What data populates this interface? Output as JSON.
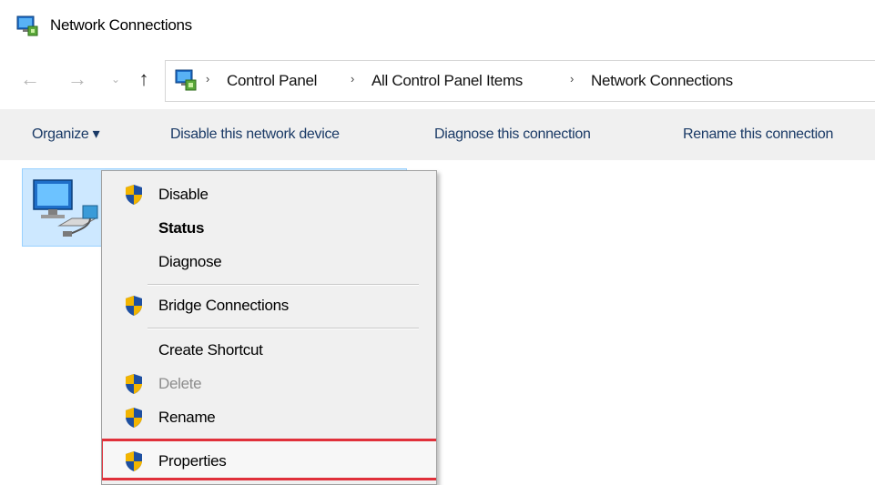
{
  "window": {
    "title": "Network Connections"
  },
  "nav": {
    "back": "←",
    "forward": "→",
    "recent": "⌄",
    "up": "↑",
    "breadcrumb": [
      "Control Panel",
      "All Control Panel Items",
      "Network Connections"
    ],
    "separator": "›"
  },
  "toolbar": {
    "organize": "Organize ▾",
    "disable_device": "Disable this network device",
    "diagnose": "Diagnose this connection",
    "rename": "Rename this connection"
  },
  "context_menu": {
    "items": [
      {
        "label": "Disable",
        "shield": true,
        "style": "normal"
      },
      {
        "label": "Status",
        "shield": false,
        "style": "bold"
      },
      {
        "label": "Diagnose",
        "shield": false,
        "style": "normal"
      },
      {
        "label": "Bridge Connections",
        "shield": true,
        "style": "normal"
      },
      {
        "label": "Create Shortcut",
        "shield": false,
        "style": "normal"
      },
      {
        "label": "Delete",
        "shield": true,
        "style": "disabled"
      },
      {
        "label": "Rename",
        "shield": true,
        "style": "normal"
      },
      {
        "label": "Properties",
        "shield": true,
        "style": "highlighted"
      }
    ]
  },
  "colors": {
    "selection_fill": "#cde8ff",
    "highlight_border": "#e0303a",
    "toolbar_bg": "#f0f0f0"
  },
  "icons": {
    "title": "network-connections-icon",
    "address": "control-panel-icon",
    "connection": "network-adapter-icon",
    "menu_shield": "uac-shield-icon"
  }
}
